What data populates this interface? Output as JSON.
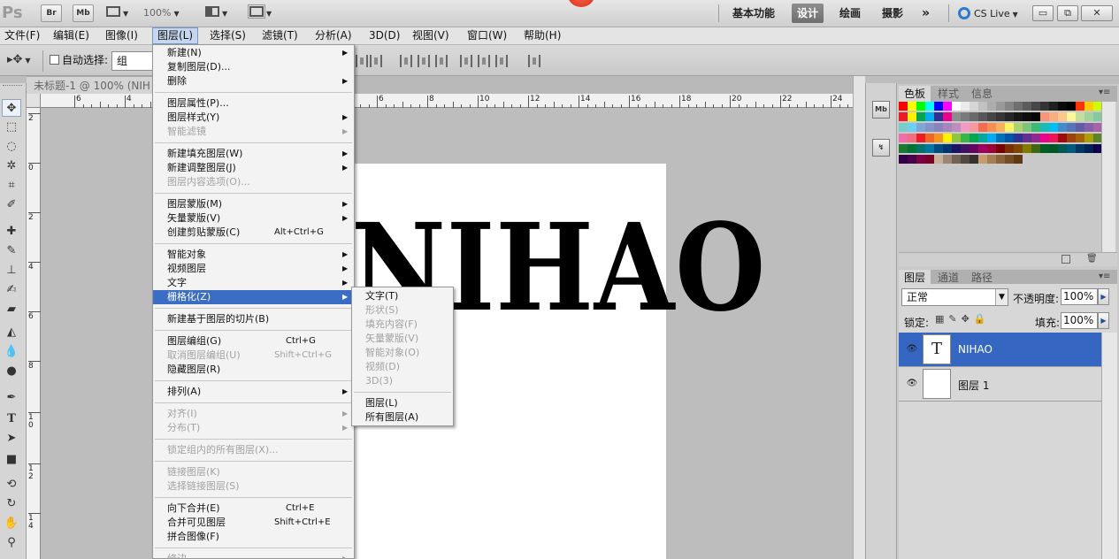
{
  "app": {
    "logo": "Ps",
    "zoom": "100%"
  },
  "titlebar": {
    "br_label": "Br",
    "mb_label": "Mb",
    "workspaces": [
      "基本功能",
      "设计",
      "绘画",
      "摄影"
    ],
    "more": "»",
    "cslive": "CS Live",
    "win_min": "▭",
    "win_restore": "⧉",
    "win_close": "✕"
  },
  "menubar": [
    "文件(F)",
    "编辑(E)",
    "图像(I)",
    "图层(L)",
    "选择(S)",
    "滤镜(T)",
    "分析(A)",
    "3D(D)",
    "视图(V)",
    "窗口(W)",
    "帮助(H)"
  ],
  "options": {
    "auto_select_label": "自动选择:",
    "group_value": "组"
  },
  "document": {
    "tab_title": "未标题-1 @ 100% (NIH",
    "text": "NIHAO"
  },
  "rulers": {
    "top": [
      "6",
      "4",
      "2",
      "0",
      "2",
      "4",
      "6",
      "8",
      "10",
      "12",
      "14",
      "16",
      "18",
      "20",
      "22",
      "24",
      "26",
      "28",
      "30"
    ],
    "left": [
      "2",
      "0",
      "2",
      "4",
      "6",
      "8",
      "1\n0",
      "1\n2",
      "1\n4"
    ]
  },
  "layer_menu": {
    "items": [
      {
        "label": "新建(N)",
        "arrow": true
      },
      {
        "label": "复制图层(D)...",
        "arrow": false
      },
      {
        "label": "删除",
        "arrow": true
      },
      {
        "sep": true
      },
      {
        "label": "图层属性(P)...",
        "arrow": false
      },
      {
        "label": "图层样式(Y)",
        "arrow": true
      },
      {
        "label": "智能滤镜",
        "arrow": true,
        "disabled": true
      },
      {
        "sep": true
      },
      {
        "label": "新建填充图层(W)",
        "arrow": true
      },
      {
        "label": "新建调整图层(J)",
        "arrow": true
      },
      {
        "label": "图层内容选项(O)...",
        "disabled": true
      },
      {
        "sep": true
      },
      {
        "label": "图层蒙版(M)",
        "arrow": true
      },
      {
        "label": "矢量蒙版(V)",
        "arrow": true
      },
      {
        "label": "创建剪贴蒙版(C)",
        "shortcut": "Alt+Ctrl+G"
      },
      {
        "sep": true
      },
      {
        "label": "智能对象",
        "arrow": true
      },
      {
        "label": "视频图层",
        "arrow": true
      },
      {
        "label": "文字",
        "arrow": true
      },
      {
        "label": "栅格化(Z)",
        "arrow": true,
        "highlighted": true
      },
      {
        "sep": true
      },
      {
        "label": "新建基于图层的切片(B)"
      },
      {
        "sep": true
      },
      {
        "label": "图层编组(G)",
        "shortcut": "Ctrl+G"
      },
      {
        "label": "取消图层编组(U)",
        "shortcut": "Shift+Ctrl+G",
        "disabled": true
      },
      {
        "label": "隐藏图层(R)"
      },
      {
        "sep": true
      },
      {
        "label": "排列(A)",
        "arrow": true
      },
      {
        "sep": true
      },
      {
        "label": "对齐(I)",
        "arrow": true,
        "disabled": true
      },
      {
        "label": "分布(T)",
        "arrow": true,
        "disabled": true
      },
      {
        "sep": true
      },
      {
        "label": "锁定组内的所有图层(X)...",
        "disabled": true
      },
      {
        "sep": true
      },
      {
        "label": "链接图层(K)",
        "disabled": true
      },
      {
        "label": "选择链接图层(S)",
        "disabled": true
      },
      {
        "sep": true
      },
      {
        "label": "向下合并(E)",
        "shortcut": "Ctrl+E"
      },
      {
        "label": "合并可见图层",
        "shortcut": "Shift+Ctrl+E"
      },
      {
        "label": "拼合图像(F)"
      },
      {
        "sep": true
      },
      {
        "label": "修边",
        "arrow": true,
        "disabled": true
      }
    ]
  },
  "rasterize_submenu": {
    "items": [
      {
        "label": "文字(T)"
      },
      {
        "label": "形状(S)",
        "disabled": true
      },
      {
        "label": "填充内容(F)",
        "disabled": true
      },
      {
        "label": "矢量蒙版(V)",
        "disabled": true
      },
      {
        "label": "智能对象(O)",
        "disabled": true
      },
      {
        "label": "视频(D)",
        "disabled": true
      },
      {
        "label": "3D(3)",
        "disabled": true
      },
      {
        "sep": true
      },
      {
        "label": "图层(L)"
      },
      {
        "label": "所有图层(A)"
      }
    ]
  },
  "panels": {
    "swatch_tabs": [
      "色板",
      "样式",
      "信息"
    ],
    "layer_tabs": [
      "图层",
      "通道",
      "路径"
    ],
    "blend_mode": "正常",
    "opacity_label": "不透明度:",
    "opacity_value": "100%",
    "lock_label": "锁定:",
    "fill_label": "填充:",
    "fill_value": "100%",
    "layers": [
      {
        "name": "NIHAO",
        "thumb": "T",
        "selected": true
      },
      {
        "name": "图层 1",
        "thumb": "",
        "selected": false
      }
    ]
  },
  "swatch_colors": [
    "#ff0000",
    "#ffff00",
    "#00ff00",
    "#00ffff",
    "#0000ff",
    "#ff00ff",
    "#ffffff",
    "#ebebeb",
    "#d6d6d6",
    "#c2c2c2",
    "#adadad",
    "#999999",
    "#858585",
    "#707070",
    "#5c5c5c",
    "#474747",
    "#333333",
    "#1f1f1f",
    "#0a0a0a",
    "#000000",
    "#ff3300",
    "#ffcc00",
    "#ccff00",
    "#ed1c24",
    "#fff200",
    "#00a651",
    "#00aeef",
    "#2e3192",
    "#ec008c",
    "#8c8c8c",
    "#7a7a7a",
    "#696969",
    "#575757",
    "#454545",
    "#363636",
    "#262626",
    "#171717",
    "#0d0d0d",
    "#050505",
    "#f7977a",
    "#f9ad81",
    "#fdc68a",
    "#fff79a",
    "#c4df9b",
    "#a3d39c",
    "#82ca9d",
    "#7bcdc8",
    "#6ecff6",
    "#7ea7d8",
    "#8493ca",
    "#8882be",
    "#a187be",
    "#bc8dbf",
    "#f49ac2",
    "#f6989d",
    "#f26c4f",
    "#f68e55",
    "#fbaf5c",
    "#fff467",
    "#acd372",
    "#7cc576",
    "#3bb878",
    "#1abbb4",
    "#00bff3",
    "#438ccb",
    "#5574b9",
    "#605ca8",
    "#855fa8",
    "#a763a8",
    "#f06eaa",
    "#f26d7d",
    "#ed1c24",
    "#f26522",
    "#f7941d",
    "#fff200",
    "#8dc63f",
    "#39b54a",
    "#00a651",
    "#00a99d",
    "#00aeef",
    "#0072bc",
    "#0054a6",
    "#2e3192",
    "#662d91",
    "#92278f",
    "#ec008c",
    "#ed145b",
    "#9e0b0f",
    "#a0410d",
    "#a3620a",
    "#aba000",
    "#598527",
    "#1a7b30",
    "#007236",
    "#00746b",
    "#0076a3",
    "#004b80",
    "#003471",
    "#1b1464",
    "#440e62",
    "#630460",
    "#9e005d",
    "#9e0039",
    "#790000",
    "#7b2e00",
    "#7d4900",
    "#827b00",
    "#406618",
    "#005e20",
    "#005826",
    "#005952",
    "#005b7f",
    "#003663",
    "#002157",
    "#0d004c",
    "#32004b",
    "#4b0049",
    "#7b0046",
    "#7a0026",
    "#c7b299",
    "#998675",
    "#736357",
    "#534741",
    "#37302d",
    "#c69c6d",
    "#a67c52",
    "#8c6239",
    "#754c24",
    "#603913"
  ]
}
